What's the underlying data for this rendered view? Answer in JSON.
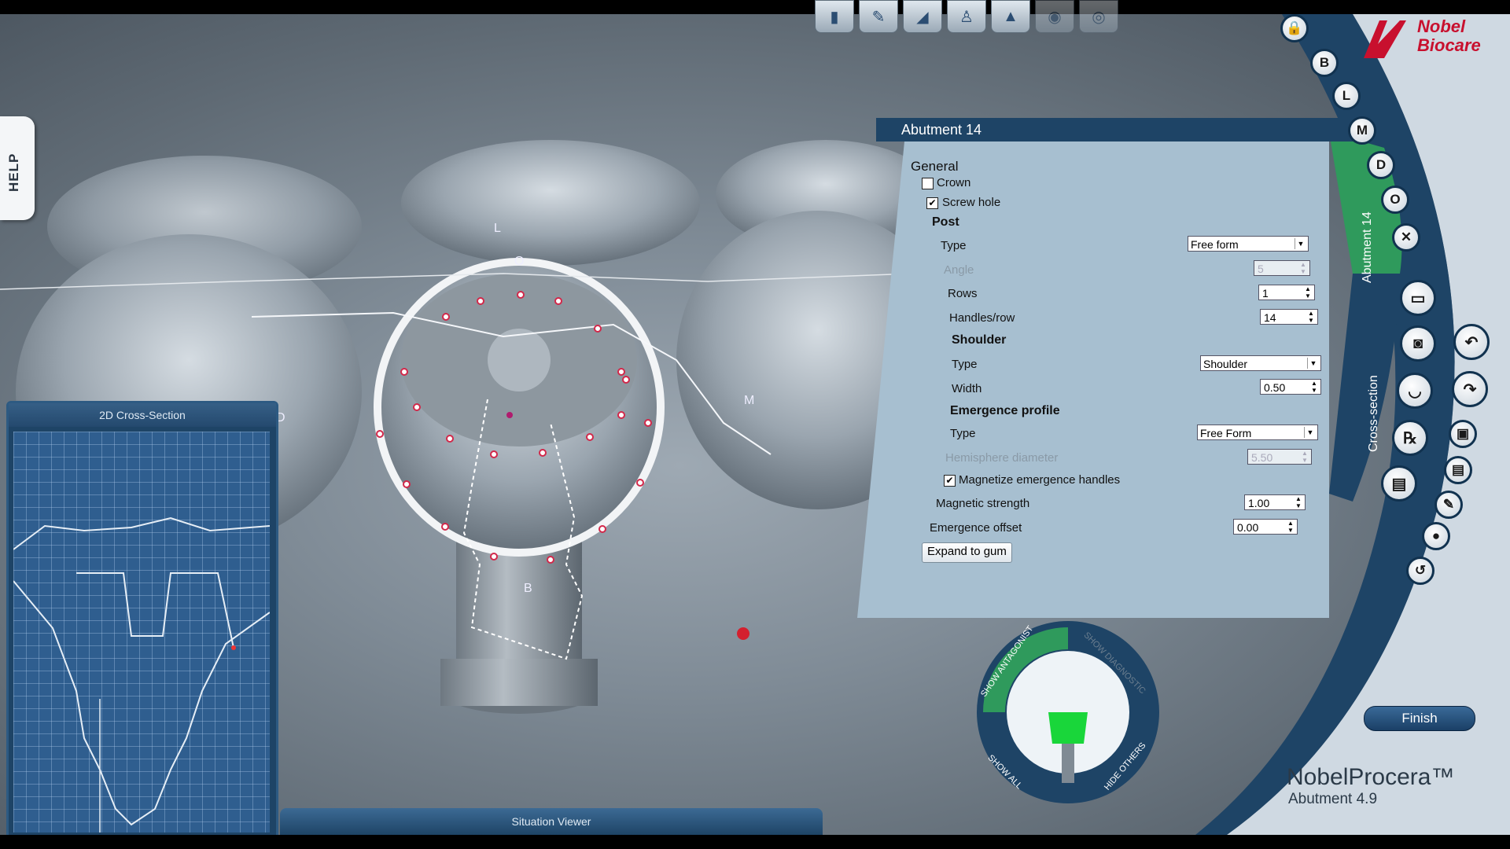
{
  "help_label": "HELP",
  "toolbar": {
    "icons": [
      "implant-icon",
      "tool-icon",
      "shoulder-icon",
      "crown-icon",
      "abutment-icon",
      "tooth-icon",
      "tooth-outline-icon"
    ]
  },
  "viewport": {
    "labels": {
      "lingual": "L",
      "occlusal": "O",
      "distal": "D",
      "mesial": "M",
      "buccal": "B"
    }
  },
  "cross_section": {
    "title": "2D Cross-Section"
  },
  "situation_viewer": {
    "title": "Situation Viewer"
  },
  "panel": {
    "title": "Abutment 14",
    "general": "General",
    "crown_label": "Crown",
    "crown_checked": false,
    "screw_hole_label": "Screw hole",
    "screw_hole_checked": true,
    "post": "Post",
    "post_type_label": "Type",
    "post_type_value": "Free form",
    "angle_label": "Angle",
    "angle_value": "5",
    "rows_label": "Rows",
    "rows_value": "1",
    "handles_label": "Handles/row",
    "handles_value": "14",
    "shoulder": "Shoulder",
    "shoulder_type_label": "Type",
    "shoulder_type_value": "Shoulder",
    "width_label": "Width",
    "width_value": "0.50",
    "emergence": "Emergence profile",
    "emergence_type_label": "Type",
    "emergence_type_value": "Free Form",
    "hemisphere_label": "Hemisphere diameter",
    "hemisphere_value": "5.50",
    "magnetize_label": "Magnetize emergence handles",
    "magnetize_checked": true,
    "magnetic_strength_label": "Magnetic strength",
    "magnetic_strength_value": "1.00",
    "emergence_offset_label": "Emergence offset",
    "emergence_offset_value": "0.00",
    "expand_button": "Expand to gum"
  },
  "side_tabs": {
    "abutment": "Abutment 14",
    "cross_section": "Cross-section"
  },
  "view_buttons": [
    "B",
    "L",
    "M",
    "D",
    "O"
  ],
  "dial": {
    "show_antagonist": "SHOW ANTAGONIST",
    "show_diagnostic": "SHOW DIAGNOSTIC",
    "show_all": "SHOW ALL",
    "hide_others": "HIDE OTHERS"
  },
  "logo": {
    "line1": "Nobel",
    "line2": "Biocare"
  },
  "finish": "Finish",
  "brand": {
    "name": "NobelProcera™",
    "version": "Abutment 4.9"
  }
}
